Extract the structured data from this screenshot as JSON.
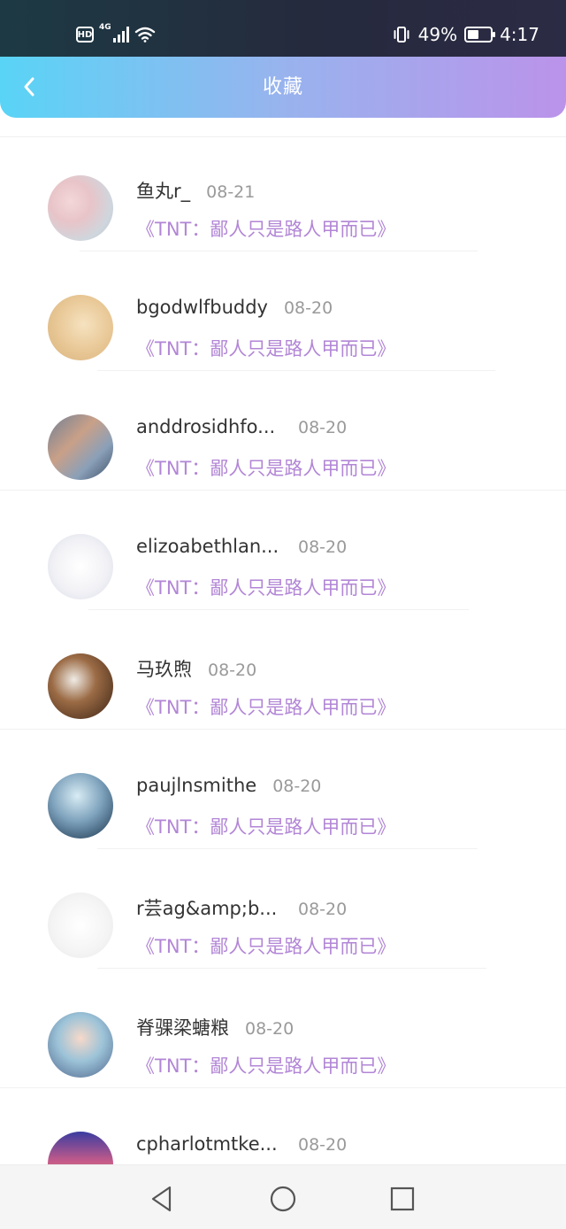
{
  "status_bar": {
    "hd": "HD",
    "network": "4G",
    "battery_percent": "49%",
    "battery_level": 0.49,
    "time": "4:17",
    "icons": [
      "hd-icon",
      "signal-icon",
      "wifi-icon",
      "vibrate-icon",
      "battery-icon"
    ]
  },
  "header": {
    "title": "收藏",
    "back_icon": "chevron-left-icon",
    "colors": [
      "#59d4f6",
      "#98b3ee",
      "#bb93ea"
    ]
  },
  "list": {
    "accent_color": "#b286d6",
    "items": [
      {
        "name": "鱼丸r_",
        "date": "08-21",
        "title": "《TNT：鄙人只是路人甲而已》"
      },
      {
        "name": "bgodwlfbuddy",
        "date": "08-20",
        "title": "《TNT：鄙人只是路人甲而已》"
      },
      {
        "name": "anddrosidhfo...",
        "date": "08-20",
        "title": "《TNT：鄙人只是路人甲而已》"
      },
      {
        "name": "elizoabethlan...",
        "date": "08-20",
        "title": "《TNT：鄙人只是路人甲而已》"
      },
      {
        "name": "马玖煦",
        "date": "08-20",
        "title": "《TNT：鄙人只是路人甲而已》"
      },
      {
        "name": "paujlnsmithe",
        "date": "08-20",
        "title": "《TNT：鄙人只是路人甲而已》"
      },
      {
        "name": "r芸ag&amp;b...",
        "date": "08-20",
        "title": "《TNT：鄙人只是路人甲而已》"
      },
      {
        "name": "脊骒梁螗粮",
        "date": "08-20",
        "title": "《TNT：鄙人只是路人甲而已》"
      },
      {
        "name": "cpharlotmtke...",
        "date": "08-20",
        "title": ""
      }
    ]
  },
  "nav_bar": {
    "icons": [
      "back-triangle-icon",
      "home-circle-icon",
      "recents-square-icon"
    ]
  }
}
